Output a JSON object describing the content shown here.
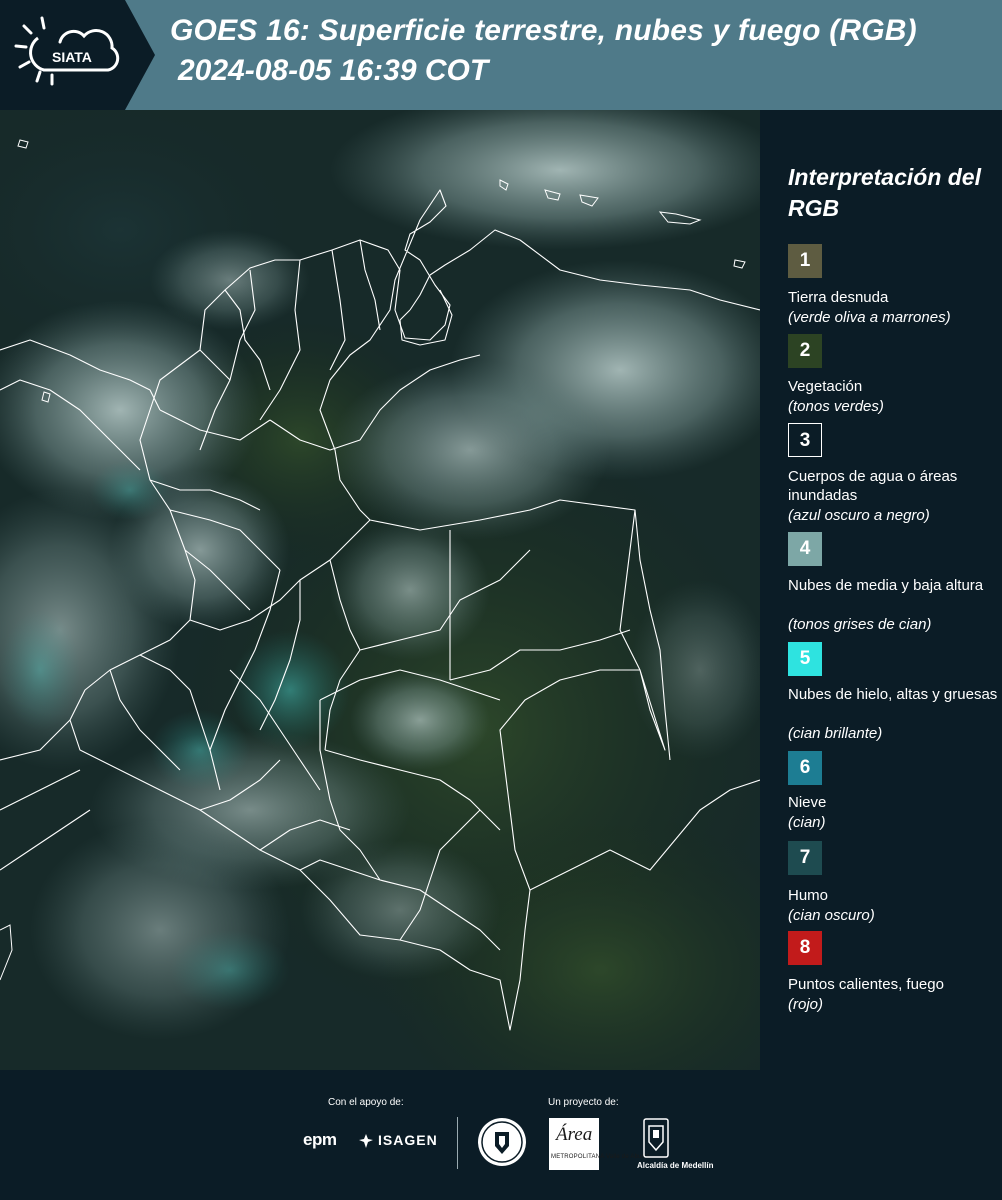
{
  "header": {
    "logo_text": "SIATA",
    "title_line1": "GOES 16: Superficie terrestre, nubes y fuego (RGB)",
    "title_line2": "2024-08-05 16:39 COT"
  },
  "legend": {
    "title": "Interpretación del RGB",
    "items": [
      {
        "num": "1",
        "label": "Tierra desnuda",
        "desc": "(verde oliva a marrones)",
        "color": "#5e5c41"
      },
      {
        "num": "2",
        "label": "Vegetación",
        "desc": "(tonos verdes)",
        "color": "#2c4323"
      },
      {
        "num": "3",
        "label": "Cuerpos de agua o áreas inundadas",
        "desc": "(azul oscuro a negro)",
        "color": "#0b1c26"
      },
      {
        "num": "4",
        "label": "Nubes de media y baja altura",
        "desc": "(tonos grises de cian)",
        "color": "#7da7a6"
      },
      {
        "num": "5",
        "label": "Nubes de hielo, altas y gruesas",
        "desc": "(cian brillante)",
        "color": "#2ee3e0"
      },
      {
        "num": "6",
        "label": "Nieve",
        "desc": "(cian)",
        "color": "#1d7d93"
      },
      {
        "num": "7",
        "label": "Humo",
        "desc": "(cian oscuro)",
        "color": "#1e4b50"
      },
      {
        "num": "8",
        "label": "Puntos calientes, fuego",
        "desc": "(rojo)",
        "color": "#c21b1b"
      }
    ]
  },
  "footer": {
    "support_label": "Con el apoyo de:",
    "project_label": "Un proyecto de:",
    "sponsor_epm": "epm",
    "sponsor_isagen": "ISAGEN",
    "area_script": "Área",
    "area_text": "METROPOLITANA Valle de Aburrá",
    "alcaldia": "Alcaldía de Medellín"
  },
  "colors": {
    "header_bg": "#4f7a89",
    "panel_bg": "#0b1c26",
    "boundary_line": "#ffffff"
  }
}
